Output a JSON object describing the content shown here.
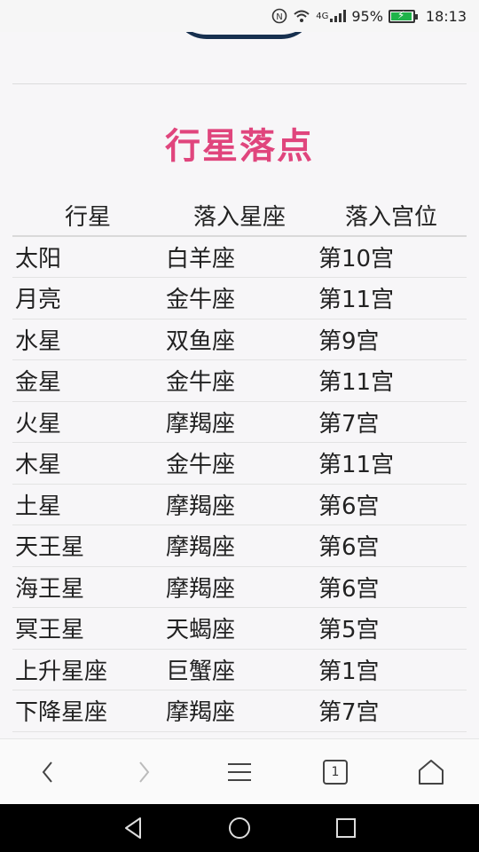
{
  "status_bar": {
    "signal_label": "4G",
    "battery_percent": "95%",
    "battery_level": 0.95,
    "time": "18:13"
  },
  "page": {
    "title": "行星落点"
  },
  "table": {
    "headers": [
      "行星",
      "落入星座",
      "落入宫位"
    ],
    "rows": [
      [
        "太阳",
        "白羊座",
        "第10宫"
      ],
      [
        "月亮",
        "金牛座",
        "第11宫"
      ],
      [
        "水星",
        "双鱼座",
        "第9宫"
      ],
      [
        "金星",
        "金牛座",
        "第11宫"
      ],
      [
        "火星",
        "摩羯座",
        "第7宫"
      ],
      [
        "木星",
        "金牛座",
        "第11宫"
      ],
      [
        "土星",
        "摩羯座",
        "第6宫"
      ],
      [
        "天王星",
        "摩羯座",
        "第6宫"
      ],
      [
        "海王星",
        "摩羯座",
        "第6宫"
      ],
      [
        "冥王星",
        "天蝎座",
        "第5宫"
      ],
      [
        "上升星座",
        "巨蟹座",
        "第1宫"
      ],
      [
        "下降星座",
        "摩羯座",
        "第7宫"
      ]
    ]
  },
  "browser_nav": {
    "tab_count": "1"
  },
  "colors": {
    "title": "#e0457d",
    "battery": "#1fb34a",
    "arc": "#17304f"
  }
}
